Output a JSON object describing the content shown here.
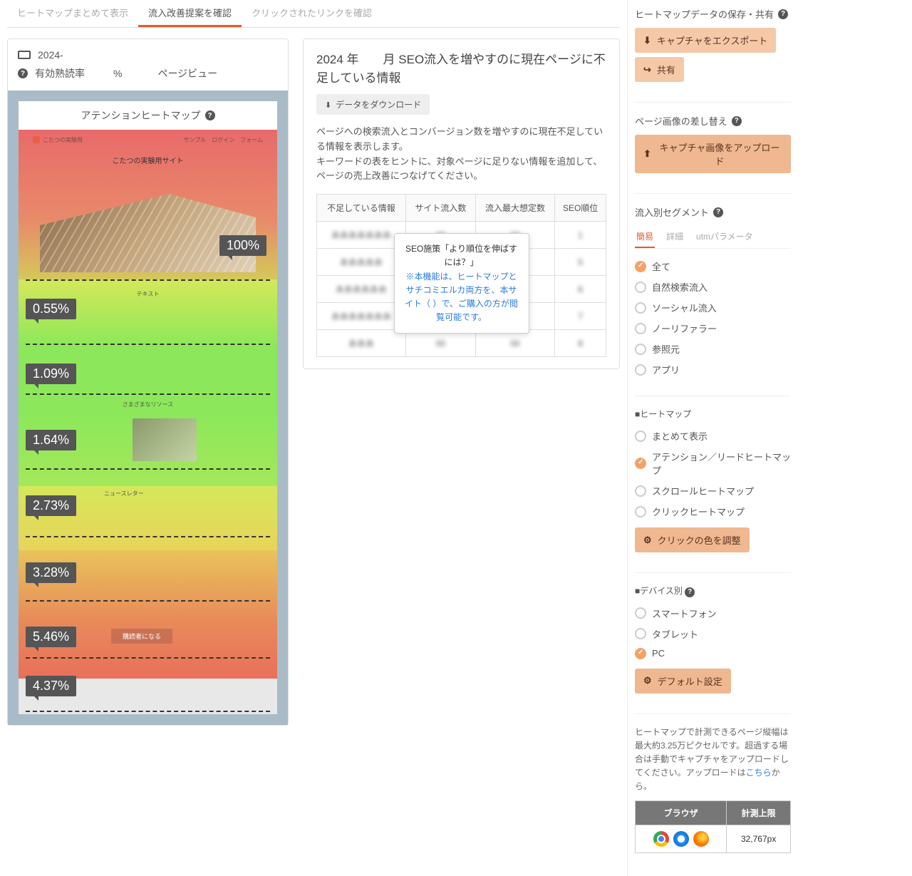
{
  "tabs": {
    "t0": "ヒートマップまとめて表示",
    "t1": "流入改善提案を確認",
    "t2": "クリックされたリンクを確認"
  },
  "meta": {
    "period": "2024-",
    "read_rate_label": "有効熟読率",
    "read_rate_unit": "%",
    "pageview_label": "ページビュー"
  },
  "heatmap": {
    "title": "アテンションヒートマップ",
    "badges": {
      "b0": "100%",
      "b1": "0.55%",
      "b2": "1.09%",
      "b3": "1.64%",
      "b4": "2.73%",
      "b5": "3.28%",
      "b6": "5.46%",
      "b7": "4.37%"
    },
    "mini": {
      "site_title": "こたつの実験用サイト",
      "text_h": "テキスト",
      "resources_h": "さまざまなリソース",
      "newsletter_h": "ニュースレター",
      "subscribe": "購読者になる"
    }
  },
  "info": {
    "title": "2024 年　　月 SEO流入を増やすのに現在ページに不足している情報",
    "download": "データをダウンロード",
    "desc1": "ページへの検索流入とコンバージョン数を増やすのに現在不足している情報を表示します。",
    "desc2": "キーワードの表をヒントに、対象ページに足りない情報を追加して、ページの売上改善につなげてください。",
    "th0": "不足している情報",
    "th1": "サイト流入数",
    "th2": "流入最大想定数",
    "th3": "SEO順位",
    "popover_title": "SEO施策「より順位を伸ばすには？」",
    "popover_body1": "※本機能は、ヒートマップとサチコミエルカ両方を、本サイト（",
    "popover_body2": "）で、ご購入の方が閲覧可能です。"
  },
  "sidebar": {
    "save_title": "ヒートマップデータの保存・共有",
    "export_btn": "キャプチャをエクスポート",
    "share_btn": "共有",
    "replace_title": "ページ画像の差し替え",
    "upload_btn": "キャプチャ画像をアップロード",
    "segment_title": "流入別セグメント",
    "seg_tabs": {
      "t0": "簡易",
      "t1": "詳細",
      "t2": "utmパラメータ"
    },
    "segments": {
      "s0": "全て",
      "s1": "自然検索流入",
      "s2": "ソーシャル流入",
      "s3": "ノーリファラー",
      "s4": "参照元",
      "s5": "アプリ"
    },
    "hm_title": "■ヒートマップ",
    "hm": {
      "h0": "まとめて表示",
      "h1": "アテンション／リードヒートマップ",
      "h2": "スクロールヒートマップ",
      "h3": "クリックヒートマップ"
    },
    "color_btn": "クリックの色を調整",
    "device_title": "■デバイス別",
    "devices": {
      "d0": "スマートフォン",
      "d1": "タブレット",
      "d2": "PC"
    },
    "default_btn": "デフォルト設定",
    "note1": "ヒートマップで計測できるページ縦幅は最大約3.25万ピクセルです。超過する場合は手動でキャプチャをアップロードしてください。アップロードは",
    "note_link": "こちら",
    "note2": "から。",
    "browser_th0": "ブラウザ",
    "browser_th1": "計測上限",
    "limit": "32,767px"
  }
}
